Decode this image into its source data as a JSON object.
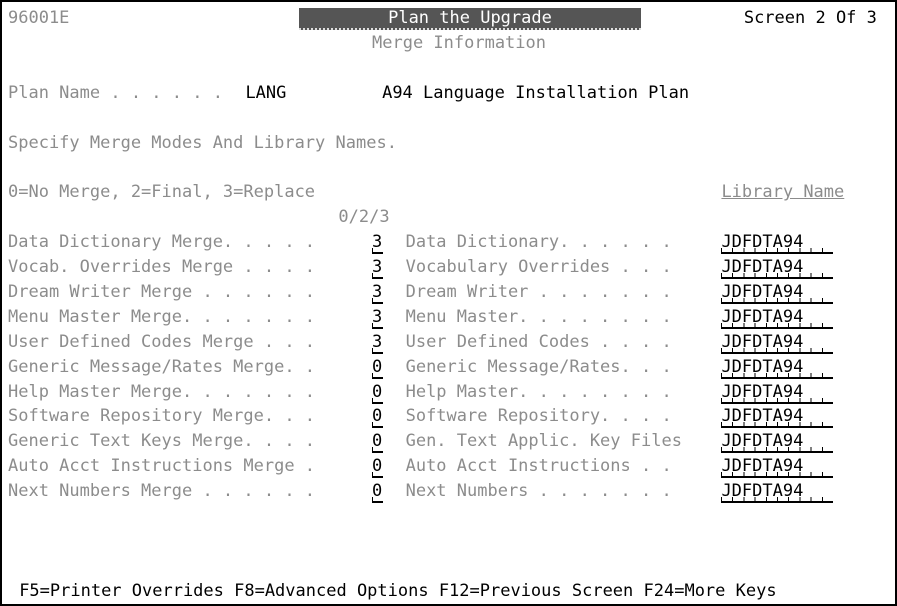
{
  "header": {
    "program_id": "96001E",
    "title": "Plan the Upgrade",
    "screen_indicator": "Screen 2 Of 3",
    "subtitle": "Merge Information"
  },
  "plan": {
    "label": "Plan Name . . . . . .",
    "name": "LANG",
    "description": "A94 Language Installation Plan"
  },
  "instruction": "Specify Merge Modes And Library Names.",
  "legend": "0=No Merge, 2=Final, 3=Replace",
  "library_header": "Library Name",
  "mode_header": "0/2/3",
  "rows": [
    {
      "merge_label": "Data Dictionary Merge. . . . .",
      "mode": "3",
      "library_label": "Data Dictionary. . . . . .",
      "library": "JDFDTA94"
    },
    {
      "merge_label": "Vocab. Overrides Merge . . . .",
      "mode": "3",
      "library_label": "Vocabulary Overrides . . .",
      "library": "JDFDTA94"
    },
    {
      "merge_label": "Dream Writer Merge . . . . . .",
      "mode": "3",
      "library_label": "Dream Writer . . . . . . .",
      "library": "JDFDTA94"
    },
    {
      "merge_label": "Menu Master Merge. . . . . . .",
      "mode": "3",
      "library_label": "Menu Master. . . . . . . .",
      "library": "JDFDTA94"
    },
    {
      "merge_label": "User Defined Codes Merge . . .",
      "mode": "3",
      "library_label": "User Defined Codes . . . .",
      "library": "JDFDTA94"
    },
    {
      "merge_label": "Generic Message/Rates Merge. .",
      "mode": "0",
      "library_label": "Generic Message/Rates. . .",
      "library": "JDFDTA94"
    },
    {
      "merge_label": "Help Master Merge. . . . . . .",
      "mode": "0",
      "library_label": "Help Master. . . . . . . .",
      "library": "JDFDTA94"
    },
    {
      "merge_label": "Software Repository Merge. . .",
      "mode": "0",
      "library_label": "Software Repository. . . .",
      "library": "JDFDTA94"
    },
    {
      "merge_label": "Generic Text Keys Merge. . . .",
      "mode": "0",
      "library_label": "Gen. Text Applic. Key Files",
      "library": "JDFDTA94"
    },
    {
      "merge_label": "Auto Acct Instructions Merge .",
      "mode": "0",
      "library_label": "Auto Acct Instructions . .",
      "library": "JDFDTA94"
    },
    {
      "merge_label": "Next Numbers Merge . . . . . .",
      "mode": "0",
      "library_label": "Next Numbers . . . . . . .",
      "library": "JDFDTA94"
    }
  ],
  "footer": "F5=Printer Overrides F8=Advanced Options F12=Previous Screen F24=More Keys"
}
